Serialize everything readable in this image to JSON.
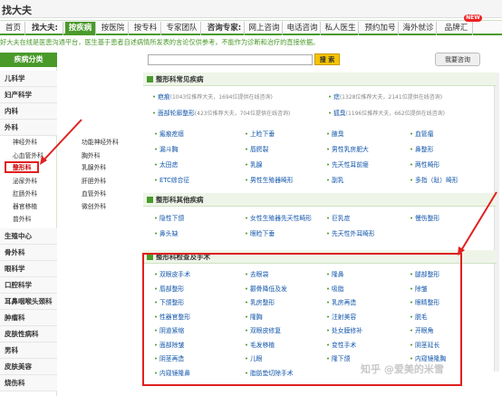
{
  "site": {
    "title": "找大夫",
    "new_badge": "NEW"
  },
  "nav": {
    "items": [
      {
        "label": "首页"
      },
      {
        "label": "找大夫:"
      },
      {
        "label": "按疾病"
      },
      {
        "label": "按医院"
      },
      {
        "label": "按专科"
      },
      {
        "label": "专家团队"
      },
      {
        "label": "咨询专家:"
      },
      {
        "label": "网上咨询"
      },
      {
        "label": "电话咨询"
      },
      {
        "label": "私人医生"
      },
      {
        "label": "预约加号"
      },
      {
        "label": "海外就诊"
      },
      {
        "label": "品牌汇"
      }
    ]
  },
  "notice": "好大夫在线是医患沟通平台，医生基于患者自述病情所发表的言论仅供参考，不能作为诊断和治疗的直接依据。",
  "sidebar": {
    "header": "疾病分类",
    "items": [
      "儿科学",
      "妇产科学",
      "内科",
      "外科",
      "生殖中心",
      "骨外科",
      "眼科学",
      "口腔科学",
      "耳鼻咽喉头颈科",
      "肿瘤科",
      "皮肤性病科",
      "男科",
      "皮肤美容",
      "烧伤科"
    ],
    "surgery_subs": [
      "神经外科",
      "功能神经外科",
      "心血管外科",
      "胸外科",
      "整形科",
      "乳腺外科",
      "泌尿外科",
      "肝胆外科",
      "肛肠外科",
      "血管外科",
      "器官移植",
      "微创外科",
      "普外科"
    ]
  },
  "search": {
    "button": "搜 索",
    "ask_button": "我要咨询"
  },
  "common": {
    "title": "整形科常见疾病",
    "top": [
      {
        "name": "疤痕",
        "meta": "(1043位推荐大夫，1694位提供在线咨询)"
      },
      {
        "name": "痣",
        "meta": "(1328位推荐大夫，2141位提供在线咨询)"
      },
      {
        "name": "面部轮廓整形",
        "meta": "(423位推荐大夫，704位提供在线咨询)"
      },
      {
        "name": "狐臭",
        "meta": "(1196位推荐大夫，662位提供在线咨询)"
      }
    ],
    "links": [
      "瘢痕疙瘩",
      "上睑下垂",
      "腋臭",
      "血管瘤",
      "漏斗胸",
      "唇腭裂",
      "男性乳房肥大",
      "鼻整形",
      "太田痣",
      "乳腺",
      "先天性耳前瘘",
      "两性畸形",
      "ETC综合征",
      "男性生殖器畸形",
      "副乳",
      "多指（趾）畸形"
    ]
  },
  "other": {
    "title": "整形科其他疾病",
    "links": [
      "隐性下颌",
      "女性生殖器先天性畸形",
      "巨乳症",
      "慢伤整形",
      "鼻头缺",
      "眼睑下垂",
      "先天性外耳畸形",
      ""
    ]
  },
  "surgery": {
    "title": "整形科检查及手术",
    "links": [
      "双眼皮手术",
      "去眼袋",
      "隆鼻",
      "腿部整形",
      "唇部整形",
      "颧骨降低及发",
      "吸脂",
      "除皱",
      "下颌整形",
      "乳房整形",
      "乳房再造",
      "眼睛整形",
      "性器官整形",
      "隆胸",
      "注射美容",
      "脱毛",
      "阴道紧缩",
      "双眼皮修复",
      "处女膜修补",
      "开眼角",
      "面部除皱",
      "毛发移植",
      "变性手术",
      "阴茎延长",
      "阴茎再造",
      "儿眼",
      "隆下颌",
      "内窥镜隆胸",
      "内窥镜隆鼻",
      "脂肪垫切除手术",
      "",
      ""
    ]
  },
  "watermark": "知乎 @爱美的米雪"
}
